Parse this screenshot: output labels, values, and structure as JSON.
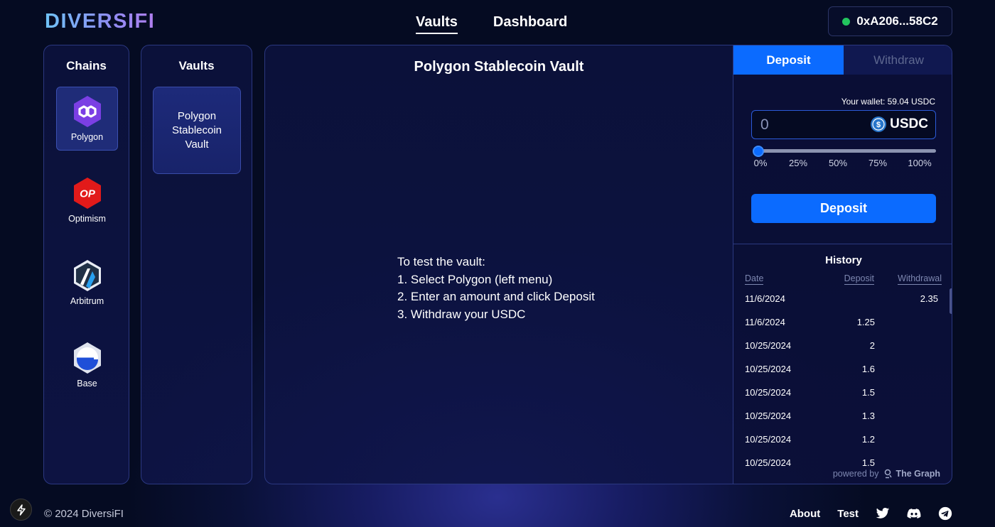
{
  "brand": {
    "name": "DIVERSIFI"
  },
  "nav": {
    "items": [
      {
        "label": "Vaults",
        "active": true
      },
      {
        "label": "Dashboard",
        "active": false
      }
    ]
  },
  "wallet": {
    "address": "0xA206...58C2",
    "status_color": "#22c55e"
  },
  "chains": {
    "title": "Chains",
    "items": [
      {
        "label": "Polygon",
        "icon": "polygon-icon",
        "selected": true
      },
      {
        "label": "Optimism",
        "icon": "optimism-icon",
        "selected": false
      },
      {
        "label": "Arbitrum",
        "icon": "arbitrum-icon",
        "selected": false
      },
      {
        "label": "Base",
        "icon": "base-icon",
        "selected": false
      }
    ]
  },
  "vaults": {
    "title": "Vaults",
    "items": [
      {
        "label": "Polygon Stablecoin Vault",
        "selected": true
      }
    ]
  },
  "main": {
    "title": "Polygon Stablecoin Vault",
    "instructions": [
      "To test the vault:",
      "1. Select Polygon (left menu)",
      "2. Enter an amount and click Deposit",
      "3. Withdraw your USDC"
    ]
  },
  "actions": {
    "tabs": [
      {
        "label": "Deposit",
        "active": true
      },
      {
        "label": "Withdraw",
        "active": false
      }
    ],
    "wallet_balance": "Your wallet: 59.04 USDC",
    "amount_placeholder": "0",
    "token": "USDC",
    "slider": {
      "value_percent": 0,
      "marks": [
        "0%",
        "25%",
        "50%",
        "75%",
        "100%"
      ]
    },
    "submit_label": "Deposit"
  },
  "history": {
    "title": "History",
    "columns": [
      "Date",
      "Deposit",
      "Withdrawal"
    ],
    "rows": [
      {
        "date": "11/6/2024",
        "deposit": "",
        "withdrawal": "2.35"
      },
      {
        "date": "11/6/2024",
        "deposit": "1.25",
        "withdrawal": ""
      },
      {
        "date": "10/25/2024",
        "deposit": "2",
        "withdrawal": ""
      },
      {
        "date": "10/25/2024",
        "deposit": "1.6",
        "withdrawal": ""
      },
      {
        "date": "10/25/2024",
        "deposit": "1.5",
        "withdrawal": ""
      },
      {
        "date": "10/25/2024",
        "deposit": "1.3",
        "withdrawal": ""
      },
      {
        "date": "10/25/2024",
        "deposit": "1.2",
        "withdrawal": ""
      },
      {
        "date": "10/25/2024",
        "deposit": "1.5",
        "withdrawal": ""
      }
    ],
    "powered_by": "powered by",
    "provider": "The Graph"
  },
  "footer": {
    "copyright": "© 2024 DiversiFI",
    "links": [
      "About",
      "Test"
    ],
    "social": [
      "twitter-icon",
      "discord-icon",
      "telegram-icon"
    ]
  },
  "colors": {
    "accent": "#0b6bff",
    "background": "#050b22",
    "panel_border": "#2b3880"
  }
}
